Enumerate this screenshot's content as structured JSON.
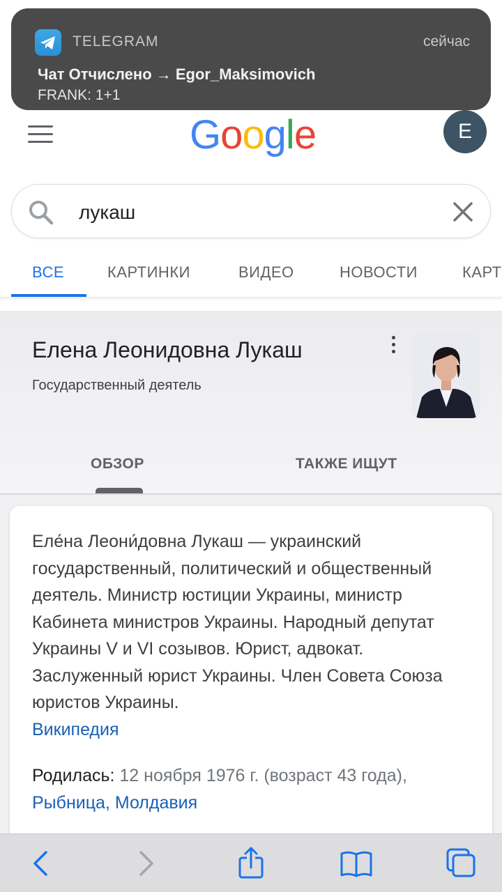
{
  "notification": {
    "app_name": "TELEGRAM",
    "time": "сейчас",
    "title": "Чат Отчислено → Egor_Maksimovich",
    "body": "FRANK: 1+1"
  },
  "header": {
    "logo_letters": [
      "G",
      "o",
      "o",
      "g",
      "l",
      "e"
    ],
    "logo_colors": [
      "#4285F4",
      "#EA4335",
      "#FBBC05",
      "#4285F4",
      "#34A853",
      "#EA4335"
    ],
    "avatar_letter": "E"
  },
  "search": {
    "query": "лукаш"
  },
  "tabs": [
    {
      "label": "ВСЕ",
      "active": true
    },
    {
      "label": "КАРТИНКИ",
      "active": false
    },
    {
      "label": "ВИДЕО",
      "active": false
    },
    {
      "label": "НОВОСТИ",
      "active": false
    },
    {
      "label": "КАРТ",
      "active": false
    }
  ],
  "knowledge_panel": {
    "name": "Елена Леонидовна Лукаш",
    "description": "Государственный деятель",
    "tabs": [
      "ОБЗОР",
      "ТАКЖЕ ИЩУТ"
    ]
  },
  "card": {
    "summary": "Еле́на Леони́довна Лукаш — украинский государственный, политический и общественный деятель. Министр юстиции Украины, министр Кабинета министров Украины. Народный депутат Украины V и VI созывов. Юрист, адвокат. Заслуженный юрист Украины. Член Совета Союза юристов Украины.",
    "source_link": "Википедия",
    "born_label": "Родилась:",
    "born_value": "12 ноября 1976 г. (возраст 43 года),",
    "born_place": "Рыбница, Молдавия"
  },
  "colors": {
    "accent": "#1a73e8",
    "link": "#1a5fb4",
    "notification_bg": "#4a4a4a"
  },
  "toolbar": {
    "icons": [
      "back-icon",
      "forward-icon",
      "share-icon",
      "bookmarks-icon",
      "tabs-icon"
    ]
  }
}
